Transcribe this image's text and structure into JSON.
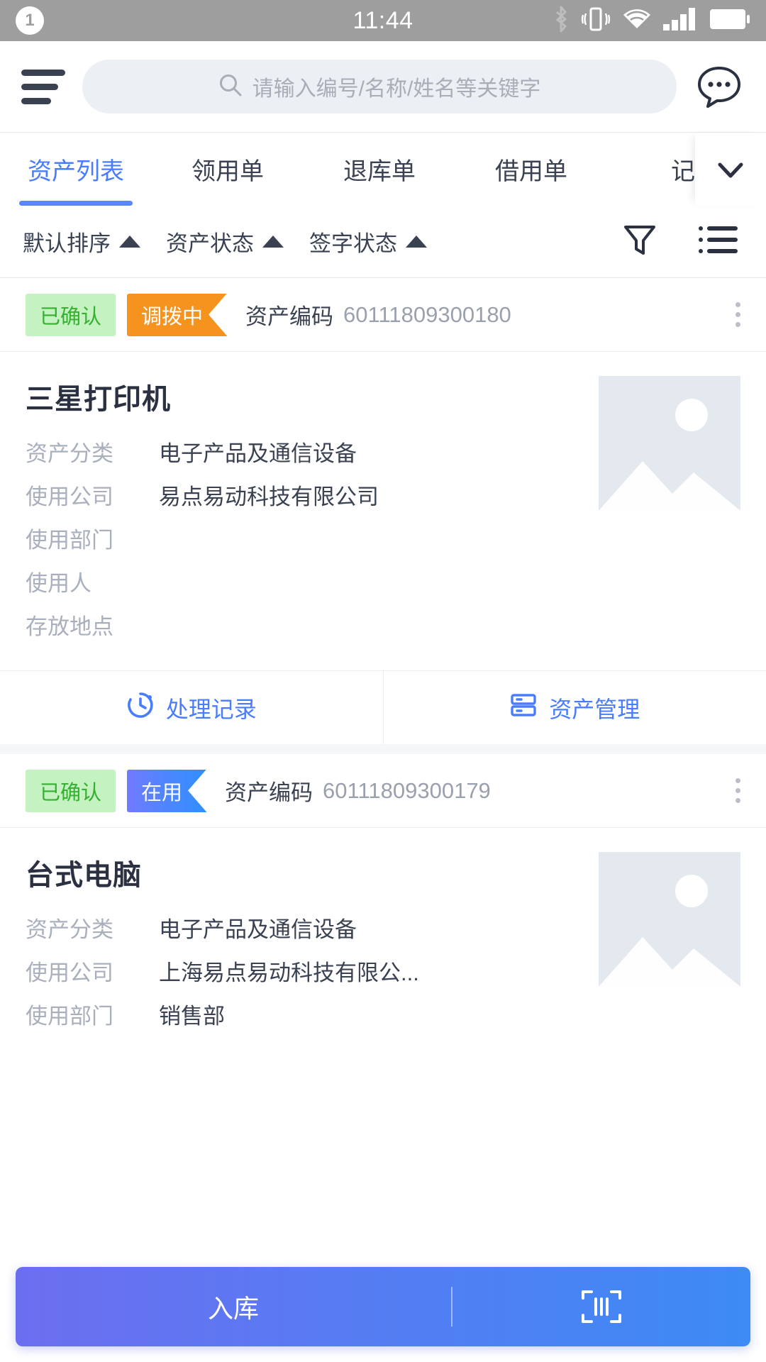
{
  "status_bar": {
    "notification_count": "1",
    "time": "11:44",
    "icons": [
      "bluetooth-icon",
      "vibrate-icon",
      "wifi-icon",
      "signal-icon",
      "battery-icon"
    ],
    "background_color": "#9e9e9e"
  },
  "header": {
    "menu_icon": "hamburger-menu-icon",
    "search": {
      "icon": "search-icon",
      "placeholder": "请输入编号/名称/姓名等关键字",
      "value": ""
    },
    "chat_icon": "chat-bubble-icon"
  },
  "tabs": {
    "items": [
      {
        "label": "资产列表",
        "active": true
      },
      {
        "label": "领用单",
        "active": false
      },
      {
        "label": "退库单",
        "active": false
      },
      {
        "label": "借用单",
        "active": false
      },
      {
        "label": "记",
        "active": false
      }
    ],
    "expand_icon": "chevron-down-icon",
    "active_color": "#4a7dfd"
  },
  "filters": {
    "items": [
      {
        "label": "默认排序",
        "icon": "caret-up-icon"
      },
      {
        "label": "资产状态",
        "icon": "caret-up-icon"
      },
      {
        "label": "签字状态",
        "icon": "caret-up-icon"
      }
    ],
    "funnel_icon": "filter-funnel-icon",
    "list_icon": "list-view-icon"
  },
  "cards": [
    {
      "status_badge": {
        "label": "已确认",
        "color": "#35b030",
        "background": "#c4f3c1"
      },
      "state_badge": {
        "label": "调拨中",
        "color": "#ffffff",
        "background": "#f5931e"
      },
      "code_label": "资产编码",
      "code_value": "60111809300180",
      "more_icon": "more-vertical-icon",
      "title": "三星打印机",
      "thumbnail_icon": "image-placeholder-icon",
      "rows": [
        {
          "label": "资产分类",
          "value": "电子产品及通信设备"
        },
        {
          "label": "使用公司",
          "value": "易点易动科技有限公司"
        },
        {
          "label": "使用部门",
          "value": ""
        },
        {
          "label": "使用人",
          "value": ""
        },
        {
          "label": "存放地点",
          "value": ""
        }
      ],
      "actions": [
        {
          "label": "处理记录",
          "icon": "history-clock-icon"
        },
        {
          "label": "资产管理",
          "icon": "asset-manage-icon"
        }
      ]
    },
    {
      "status_badge": {
        "label": "已确认",
        "color": "#35b030",
        "background": "#c4f3c1"
      },
      "state_badge": {
        "label": "在用",
        "color": "#ffffff",
        "background": "#3d8bf5"
      },
      "code_label": "资产编码",
      "code_value": "60111809300179",
      "more_icon": "more-vertical-icon",
      "title": "台式电脑",
      "thumbnail_icon": "image-placeholder-icon",
      "rows": [
        {
          "label": "资产分类",
          "value": "电子产品及通信设备"
        },
        {
          "label": "使用公司",
          "value": "上海易点易动科技有限公..."
        },
        {
          "label": "使用部门",
          "value": "销售部"
        }
      ],
      "actions": []
    }
  ],
  "bottom_bar": {
    "primary_label": "入库",
    "scan_icon": "scan-barcode-icon",
    "gradient_from": "#6c6ef0",
    "gradient_to": "#3d8bf5"
  }
}
